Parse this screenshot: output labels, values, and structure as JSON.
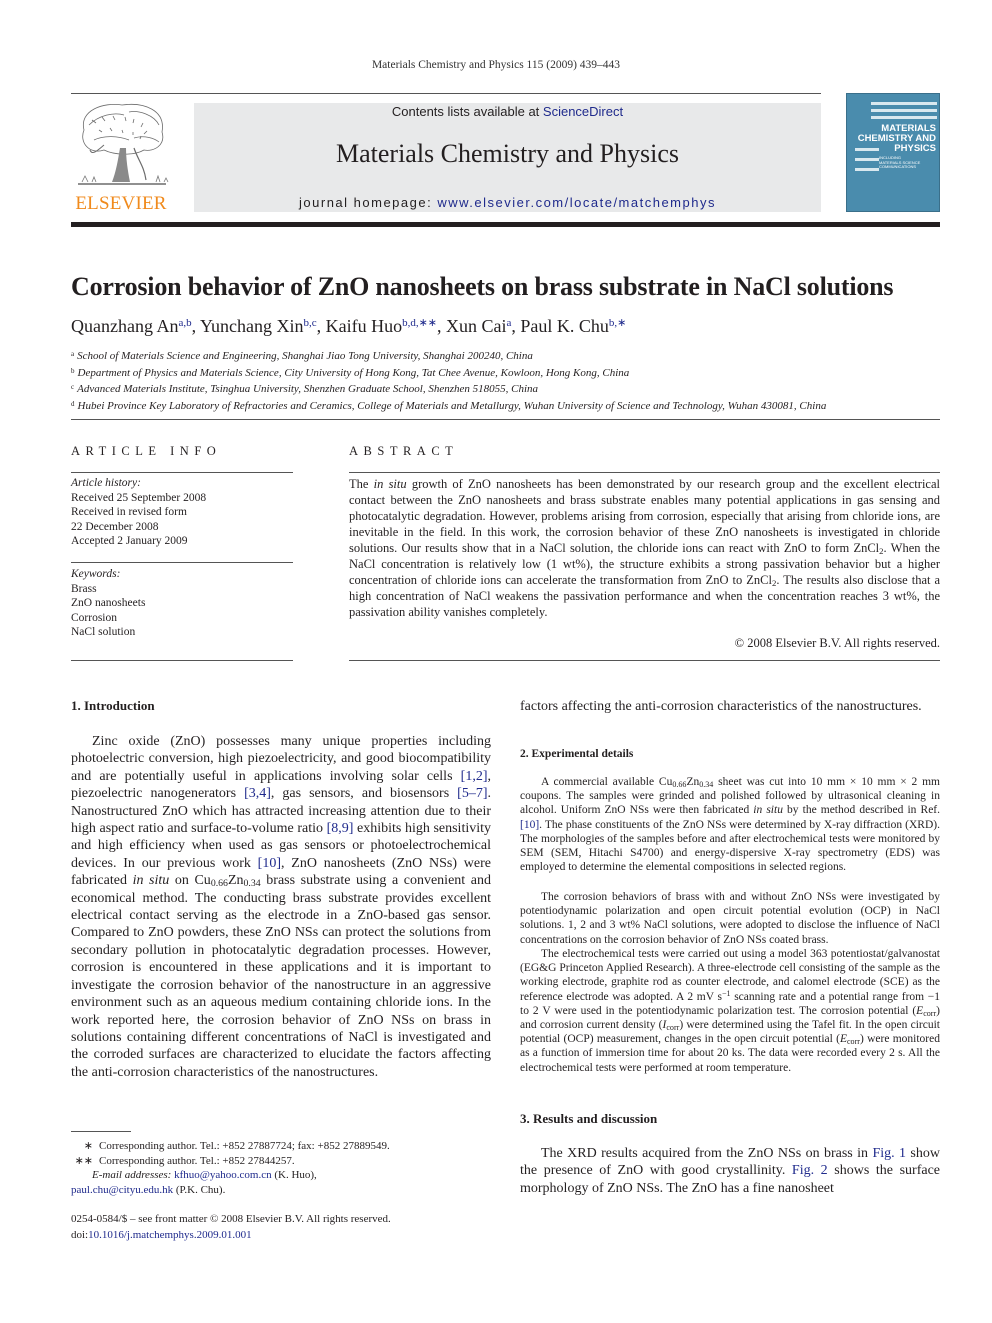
{
  "running_head": "Materials Chemistry and Physics 115 (2009) 439–443",
  "masthead": {
    "contents_prefix": "Contents lists available at ",
    "contents_link": "ScienceDirect",
    "journal_name": "Materials Chemistry and Physics",
    "homepage_prefix": "journal homepage: ",
    "homepage_url": "www.elsevier.com/locate/matchemphys",
    "publisher_logo_text": "ELSEVIER",
    "cover": {
      "title_lines": [
        "MATERIALS",
        "CHEMISTRY AND",
        "PHYSICS"
      ],
      "subtitle_lines": [
        "INCLUDING",
        "MATERIALS SCIENCE",
        "COMMUNICATIONS"
      ],
      "color": "#4a8cad"
    }
  },
  "article": {
    "title": "Corrosion behavior of ZnO nanosheets on brass substrate in NaCl solutions",
    "authors": [
      {
        "name": "Quanzhang An",
        "sup": "a,b",
        "sep": ", "
      },
      {
        "name": "Yunchang Xin",
        "sup": "b,c",
        "sep": ", "
      },
      {
        "name": "Kaifu Huo",
        "sup": "b,d,∗∗",
        "sep": ", "
      },
      {
        "name": "Xun Cai",
        "sup": "a",
        "sep": ", "
      },
      {
        "name": "Paul K. Chu",
        "sup": "b,∗",
        "sep": ""
      }
    ],
    "affiliations": [
      {
        "key": "a",
        "text": "School of Materials Science and Engineering, Shanghai Jiao Tong University, Shanghai 200240, China"
      },
      {
        "key": "b",
        "text": "Department of Physics and Materials Science, City University of Hong Kong, Tat Chee Avenue, Kowloon, Hong Kong, China"
      },
      {
        "key": "c",
        "text": "Advanced Materials Institute, Tsinghua University, Shenzhen Graduate School, Shenzhen 518055, China"
      },
      {
        "key": "d",
        "text": "Hubei Province Key Laboratory of Refractories and Ceramics, College of Materials and Metallurgy, Wuhan University of Science and Technology, Wuhan 430081, China"
      }
    ]
  },
  "article_info": {
    "heading": "ARTICLE INFO",
    "history_label": "Article history:",
    "history": [
      "Received 25 September 2008",
      "Received in revised form",
      "22 December 2008",
      "Accepted 2 January 2009"
    ],
    "keywords_label": "Keywords:",
    "keywords": [
      "Brass",
      "ZnO nanosheets",
      "Corrosion",
      "NaCl solution"
    ]
  },
  "abstract": {
    "heading": "ABSTRACT",
    "p1": "The ",
    "p1_italic": "in situ",
    "p2": " growth of ZnO nanosheets has been demonstrated by our research group and the excellent electrical contact between the ZnO nanosheets and brass substrate enables many potential applications in gas sensing and photocatalytic degradation. However, problems arising from corrosion, especially that arising from chloride ions, are inevitable in the field. In this work, the corrosion behavior of these ZnO nanosheets is investigated in chloride solutions. Our results show that in a NaCl solution, the chloride ions can react with ZnO to form ZnCl",
    "p3": ". When the NaCl concentration is relatively low (1 wt%), the structure exhibits a strong passivation behavior but a higher concentration of chloride ions can accelerate the transformation from ZnO to ZnCl",
    "p4": ". The results also disclose that a high concentration of NaCl weakens the passivation performance and when the concentration reaches 3 wt%, the passivation ability vanishes completely.",
    "sub2": "2",
    "copyright": "© 2008 Elsevier B.V. All rights reserved."
  },
  "intro": {
    "heading": "1.  Introduction",
    "t1": "Zinc oxide (ZnO) possesses many unique properties including photoelectric conversion, high piezoelectricity, and good biocompatibility and are potentially useful in applications involving solar cells ",
    "r1": "[1,2]",
    "t2": ", piezoelectric nanogenerators ",
    "r2": "[3,4]",
    "t3": ", gas sensors, and biosensors ",
    "r3": "[5–7]",
    "t4": ". Nanostructured ZnO which has attracted increasing attention due to their high aspect ratio and surface-to-volume ratio ",
    "r4": "[8,9]",
    "t5": " exhibits high sensitivity and high efficiency when used as gas sensors or photoelectrochemical devices. In our previous work ",
    "r5": "[10]",
    "t6": ", ZnO nanosheets (ZnO NSs) were fabricated ",
    "t6_italic": "in situ",
    "t7": " on Cu",
    "cu_sub": "0.66",
    "t8": "Zn",
    "zn_sub": "0.34",
    "t9": " brass substrate using a convenient and economical method. The conducting brass substrate provides excellent electrical contact serving as the electrode in a ZnO-based gas sensor. Compared to ZnO powders, these ZnO NSs can protect the solutions from secondary pollution in photocatalytic degradation processes. However, corrosion is encountered in these applications and it is important to investigate the corrosion behavior of the nanostructure in an aggressive environment such as an aqueous medium containing chloride ions. In the work reported here, the corrosion behavior of ZnO NSs on brass in solutions containing different concentrations of NaCl is investigated and the corroded surfaces are characterized to elucidate the factors affecting the anti-corrosion characteristics of the nanostructures."
  },
  "experimental": {
    "heading": "2.  Experimental details",
    "p1a": "A commercial available Cu",
    "p1b": "Zn",
    "p1c": " sheet was cut into 10 mm × 10 mm × 2 mm coupons. The samples were grinded and polished followed by ultrasonical cleaning in alcohol. Uniform ZnO NSs were then fabricated ",
    "p1_italic": "in situ",
    "p1d": " by the method described in Ref. ",
    "p1_ref": "[10]",
    "p1e": ". The phase constituents of the ZnO NSs were determined by X-ray diffraction (XRD). The morphologies of the samples before and after electrochemical tests were monitored by SEM (SEM, Hitachi S4700) and energy-dispersive X-ray spectrometry (EDS) was employed to determine the elemental compositions in selected regions.",
    "p2": "The corrosion behaviors of brass with and without ZnO NSs were investigated by potentiodynamic polarization and open circuit potential evolution (OCP) in NaCl solutions. 1, 2 and 3 wt% NaCl solutions, were adopted to disclose the influence of NaCl concentrations on the corrosion behavior of ZnO NSs coated brass.",
    "p3a": "The electrochemical tests were carried out using a model 363 potentiostat/galvanostat (EG&G Princeton Applied Research). A three-electrode cell consisting of the sample as the working electrode, graphite rod as counter electrode, and calomel electrode (SCE) as the reference electrode was adopted. A 2 mV s",
    "p3_sup": "−1",
    "p3b": " scanning rate and a potential range from −1 to 2 V were used in the potentiodynamic polarization test. The corrosion potential (",
    "p3_e": "E",
    "p3_corr": "corr",
    "p3c": ") and corrosion current density (",
    "p3_i": "I",
    "p3d": ") were determined using the Tafel fit. In the open circuit potential (OCP) measurement, changes in the open circuit potential (",
    "p3e": ") were monitored as a function of immersion time for about 20 ks. The data were recorded every 2 s. All the electrochemical tests were performed at room temperature."
  },
  "results": {
    "heading": "3.  Results and discussion",
    "t1": "The XRD results acquired from the ZnO NSs on brass in ",
    "fig1": "Fig. 1",
    "t2": " show the presence of ZnO with good crystallinity. ",
    "fig2": "Fig. 2",
    "t3": " shows the surface morphology of ZnO NSs. The ZnO has a fine nanosheet"
  },
  "footnotes": {
    "star1_mark": "∗",
    "star1": "Corresponding author. Tel.: +852 27887724; fax: +852 27889549.",
    "star2_mark": "∗∗",
    "star2": "Corresponding author. Tel.: +852 27844257.",
    "email_label": "E-mail addresses:",
    "email1": "kfhuo@yahoo.com.cn",
    "email1_name": " (K. Huo),",
    "email2": "paul.chu@cityu.edu.hk",
    "email2_name": " (P.K. Chu).",
    "front_matter": "0254-0584/$ – see front matter © 2008 Elsevier B.V. All rights reserved.",
    "doi_label": "doi:",
    "doi": "10.1016/j.matchemphys.2009.01.001"
  }
}
